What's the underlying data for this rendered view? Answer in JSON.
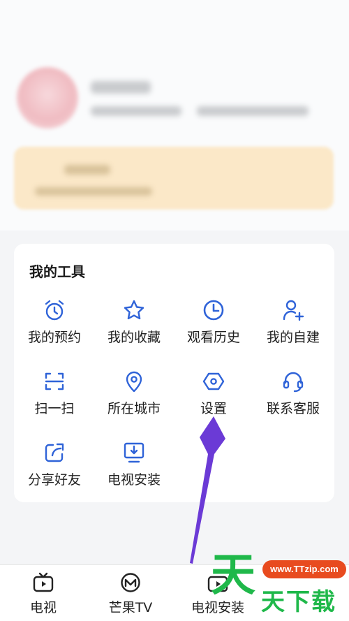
{
  "colors": {
    "accent": "#2f63d8",
    "arrow": "#6b3ad6",
    "watermark_green": "#1fb84a",
    "watermark_red": "#e84b1f"
  },
  "tools_card": {
    "title": "我的工具",
    "items": [
      {
        "label": "我的预约",
        "icon": "alarm-clock-icon"
      },
      {
        "label": "我的收藏",
        "icon": "star-icon"
      },
      {
        "label": "观看历史",
        "icon": "clock-icon"
      },
      {
        "label": "我的自建",
        "icon": "user-add-icon"
      },
      {
        "label": "扫一扫",
        "icon": "scan-icon"
      },
      {
        "label": "所在城市",
        "icon": "location-pin-icon"
      },
      {
        "label": "设置",
        "icon": "settings-hexagon-icon"
      },
      {
        "label": "联系客服",
        "icon": "headset-icon"
      },
      {
        "label": "分享好友",
        "icon": "share-icon"
      },
      {
        "label": "电视安装",
        "icon": "tv-download-icon"
      }
    ]
  },
  "tabbar": {
    "tabs": [
      {
        "label": "电视",
        "icon": "tv-icon"
      },
      {
        "label": "芒果TV",
        "icon": "mango-tv-icon"
      },
      {
        "label": "电视安装",
        "icon": "tv-install-icon"
      }
    ]
  },
  "watermark": {
    "logo": "天",
    "url": "www.TTzip.com",
    "text": "天下载"
  }
}
